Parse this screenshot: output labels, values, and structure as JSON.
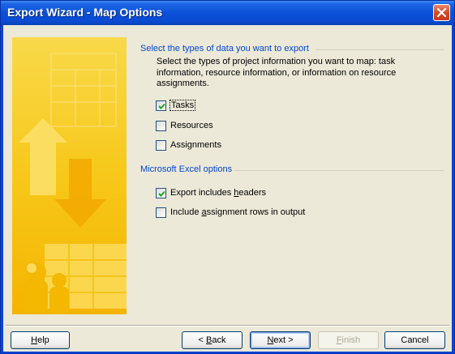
{
  "window": {
    "title": "Export Wizard - Map Options"
  },
  "export_section": {
    "heading": "Select the types of data you want to export",
    "description": "Select the types of project information you want to map: task information, resource information, or information on resource assignments.",
    "options": [
      {
        "label": "Tasks",
        "checked": true
      },
      {
        "label": "Resources",
        "checked": false
      },
      {
        "label": "Assignments",
        "checked": false
      }
    ]
  },
  "excel_section": {
    "heading": "Microsoft Excel options",
    "options": [
      {
        "label_pre": "Export includes ",
        "label_ul": "h",
        "label_post": "eaders",
        "checked": true
      },
      {
        "label_pre": "Include ",
        "label_ul": "a",
        "label_post": "ssignment rows in output",
        "checked": false
      }
    ]
  },
  "buttons": {
    "help": {
      "ul": "H",
      "rest": "elp"
    },
    "back": {
      "pre": "< ",
      "ul": "B",
      "rest": "ack"
    },
    "next": {
      "ul": "N",
      "rest": "ext >"
    },
    "finish": {
      "ul": "F",
      "rest": "inish"
    },
    "cancel": "Cancel"
  },
  "colors": {
    "title_bar": "#0a50d8",
    "section_heading": "#0046d5",
    "dialog_bg": "#ece9d8",
    "banner_yellow": "#f9c300"
  },
  "icons": {
    "close": "close-icon",
    "check": "checkmark-icon",
    "banner": "wizard-banner-graphic"
  }
}
